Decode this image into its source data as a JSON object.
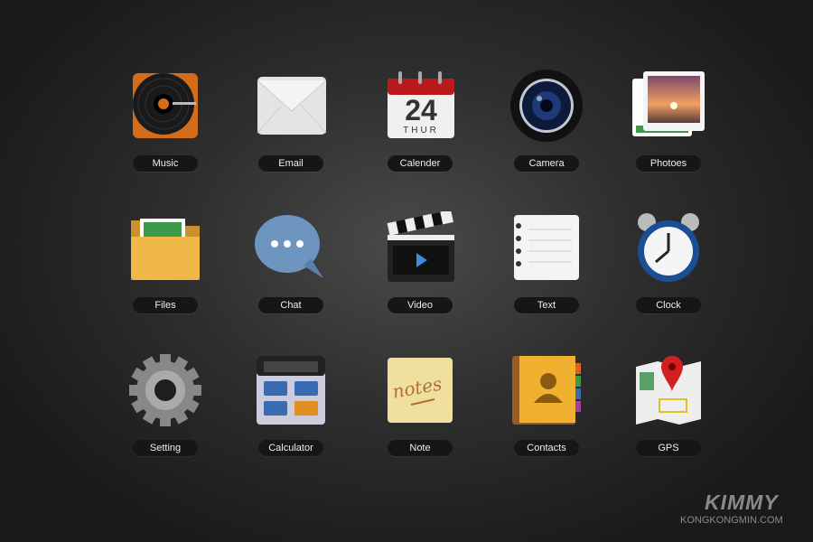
{
  "apps": [
    {
      "label": "Music",
      "icon": "music-icon"
    },
    {
      "label": "Email",
      "icon": "email-icon"
    },
    {
      "label": "Calender",
      "icon": "calendar-icon",
      "day": "24",
      "weekday": "THUR"
    },
    {
      "label": "Camera",
      "icon": "camera-icon"
    },
    {
      "label": "Photoes",
      "icon": "photos-icon"
    },
    {
      "label": "Files",
      "icon": "folder-icon"
    },
    {
      "label": "Chat",
      "icon": "chat-icon"
    },
    {
      "label": "Video",
      "icon": "video-icon"
    },
    {
      "label": "Text",
      "icon": "text-icon"
    },
    {
      "label": "Clock",
      "icon": "clock-icon"
    },
    {
      "label": "Setting",
      "icon": "gear-icon"
    },
    {
      "label": "Calculator",
      "icon": "calculator-icon"
    },
    {
      "label": "Note",
      "icon": "note-icon",
      "note_text": "notes"
    },
    {
      "label": "Contacts",
      "icon": "contacts-icon"
    },
    {
      "label": "GPS",
      "icon": "map-pin-icon"
    }
  ],
  "watermark": {
    "brand": "KIMMY",
    "site": "KONGKONGMIN.COM"
  }
}
